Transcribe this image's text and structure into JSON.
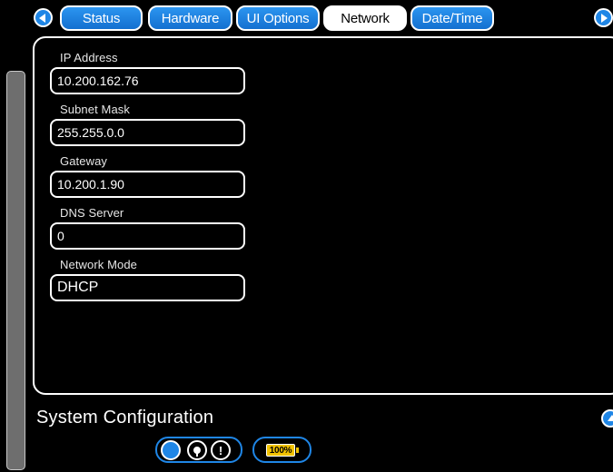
{
  "tabs": [
    {
      "label": "Status"
    },
    {
      "label": "Hardware"
    },
    {
      "label": "UI Options"
    },
    {
      "label": "Network"
    },
    {
      "label": "Date/Time"
    }
  ],
  "active_tab": "Network",
  "fields": [
    {
      "label": "IP Address",
      "value": "10.200.162.76"
    },
    {
      "label": "Subnet Mask",
      "value": "255.255.0.0"
    },
    {
      "label": "Gateway",
      "value": "10.200.1.90"
    },
    {
      "label": "DNS Server",
      "value": "0"
    },
    {
      "label": "Network Mode",
      "value": "DHCP"
    }
  ],
  "footer": {
    "title": "System Configuration",
    "battery_text": "100%"
  },
  "colors": {
    "accent_blue": "#1f86e6",
    "battery": "#f2c200",
    "background": "#000000"
  },
  "icons": {
    "nav_prev": "chevron-left-icon",
    "nav_next": "chevron-right-icon",
    "help": "up-arrow-icon",
    "status_indicator": "status-dot-icon",
    "lock": "lock-icon",
    "warning": "warning-icon",
    "battery": "battery-icon"
  }
}
